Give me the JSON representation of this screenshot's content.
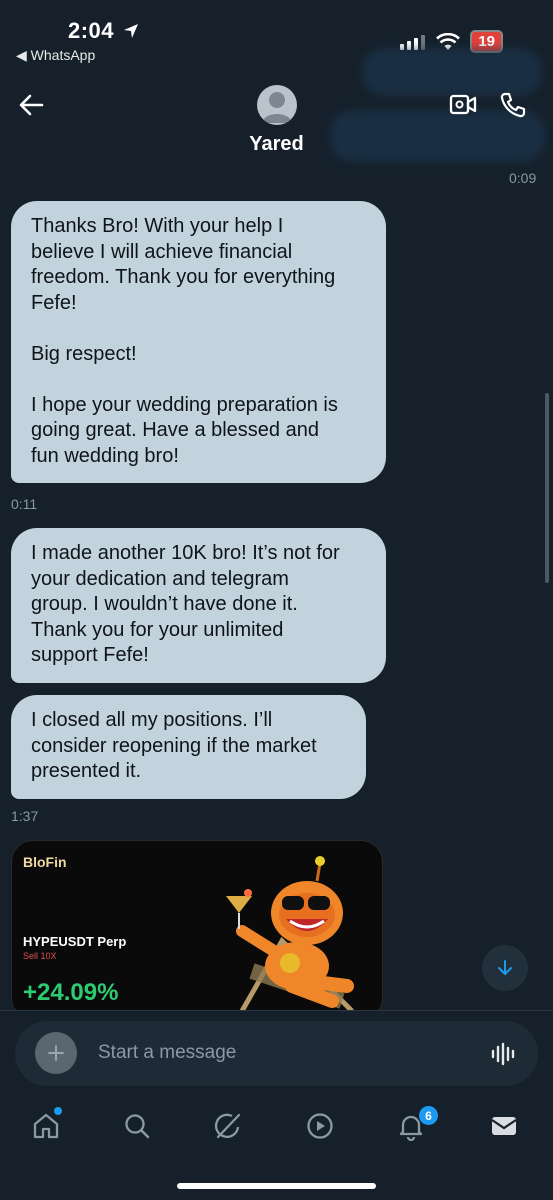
{
  "status": {
    "time": "2:04",
    "back_app": "◀ WhatsApp",
    "battery": "19"
  },
  "header": {
    "contact_name": "Yared"
  },
  "messages": {
    "top_timestamp": "0:09",
    "m1": {
      "text": "Thanks Bro! With your help I\nbelieve I will achieve financial\nfreedom. Thank you for everything\nFefe!\n\nBig respect!\n\nI hope your wedding preparation is\ngoing great. Have a blessed and\nfun wedding bro!",
      "time": "0:11"
    },
    "m2": {
      "text": "I made another 10K bro! It’s not for\nyour dedication and telegram\ngroup. I wouldn’t have done it.\nThank you for your unlimited\nsupport Fefe!"
    },
    "m3": {
      "text": "I closed all my positions. I’ll\nconsider reopening if the market\npresented it.",
      "time": "1:37"
    }
  },
  "trade_card": {
    "brand": "BloFin",
    "pair": "HYPEUSDT Perp",
    "side": "Sell  10X",
    "pnl_percent": "+24.09%"
  },
  "composer": {
    "placeholder": "Start a message"
  },
  "tabs": {
    "notifications_badge": "6",
    "items": [
      "home-icon",
      "search-icon",
      "grok-icon",
      "play-icon",
      "bell-icon",
      "mail-icon"
    ]
  },
  "colors": {
    "background": "#15202b",
    "bubble": "#c3d3de",
    "accent": "#1d9bf0",
    "pnl": "#2ecc71"
  }
}
